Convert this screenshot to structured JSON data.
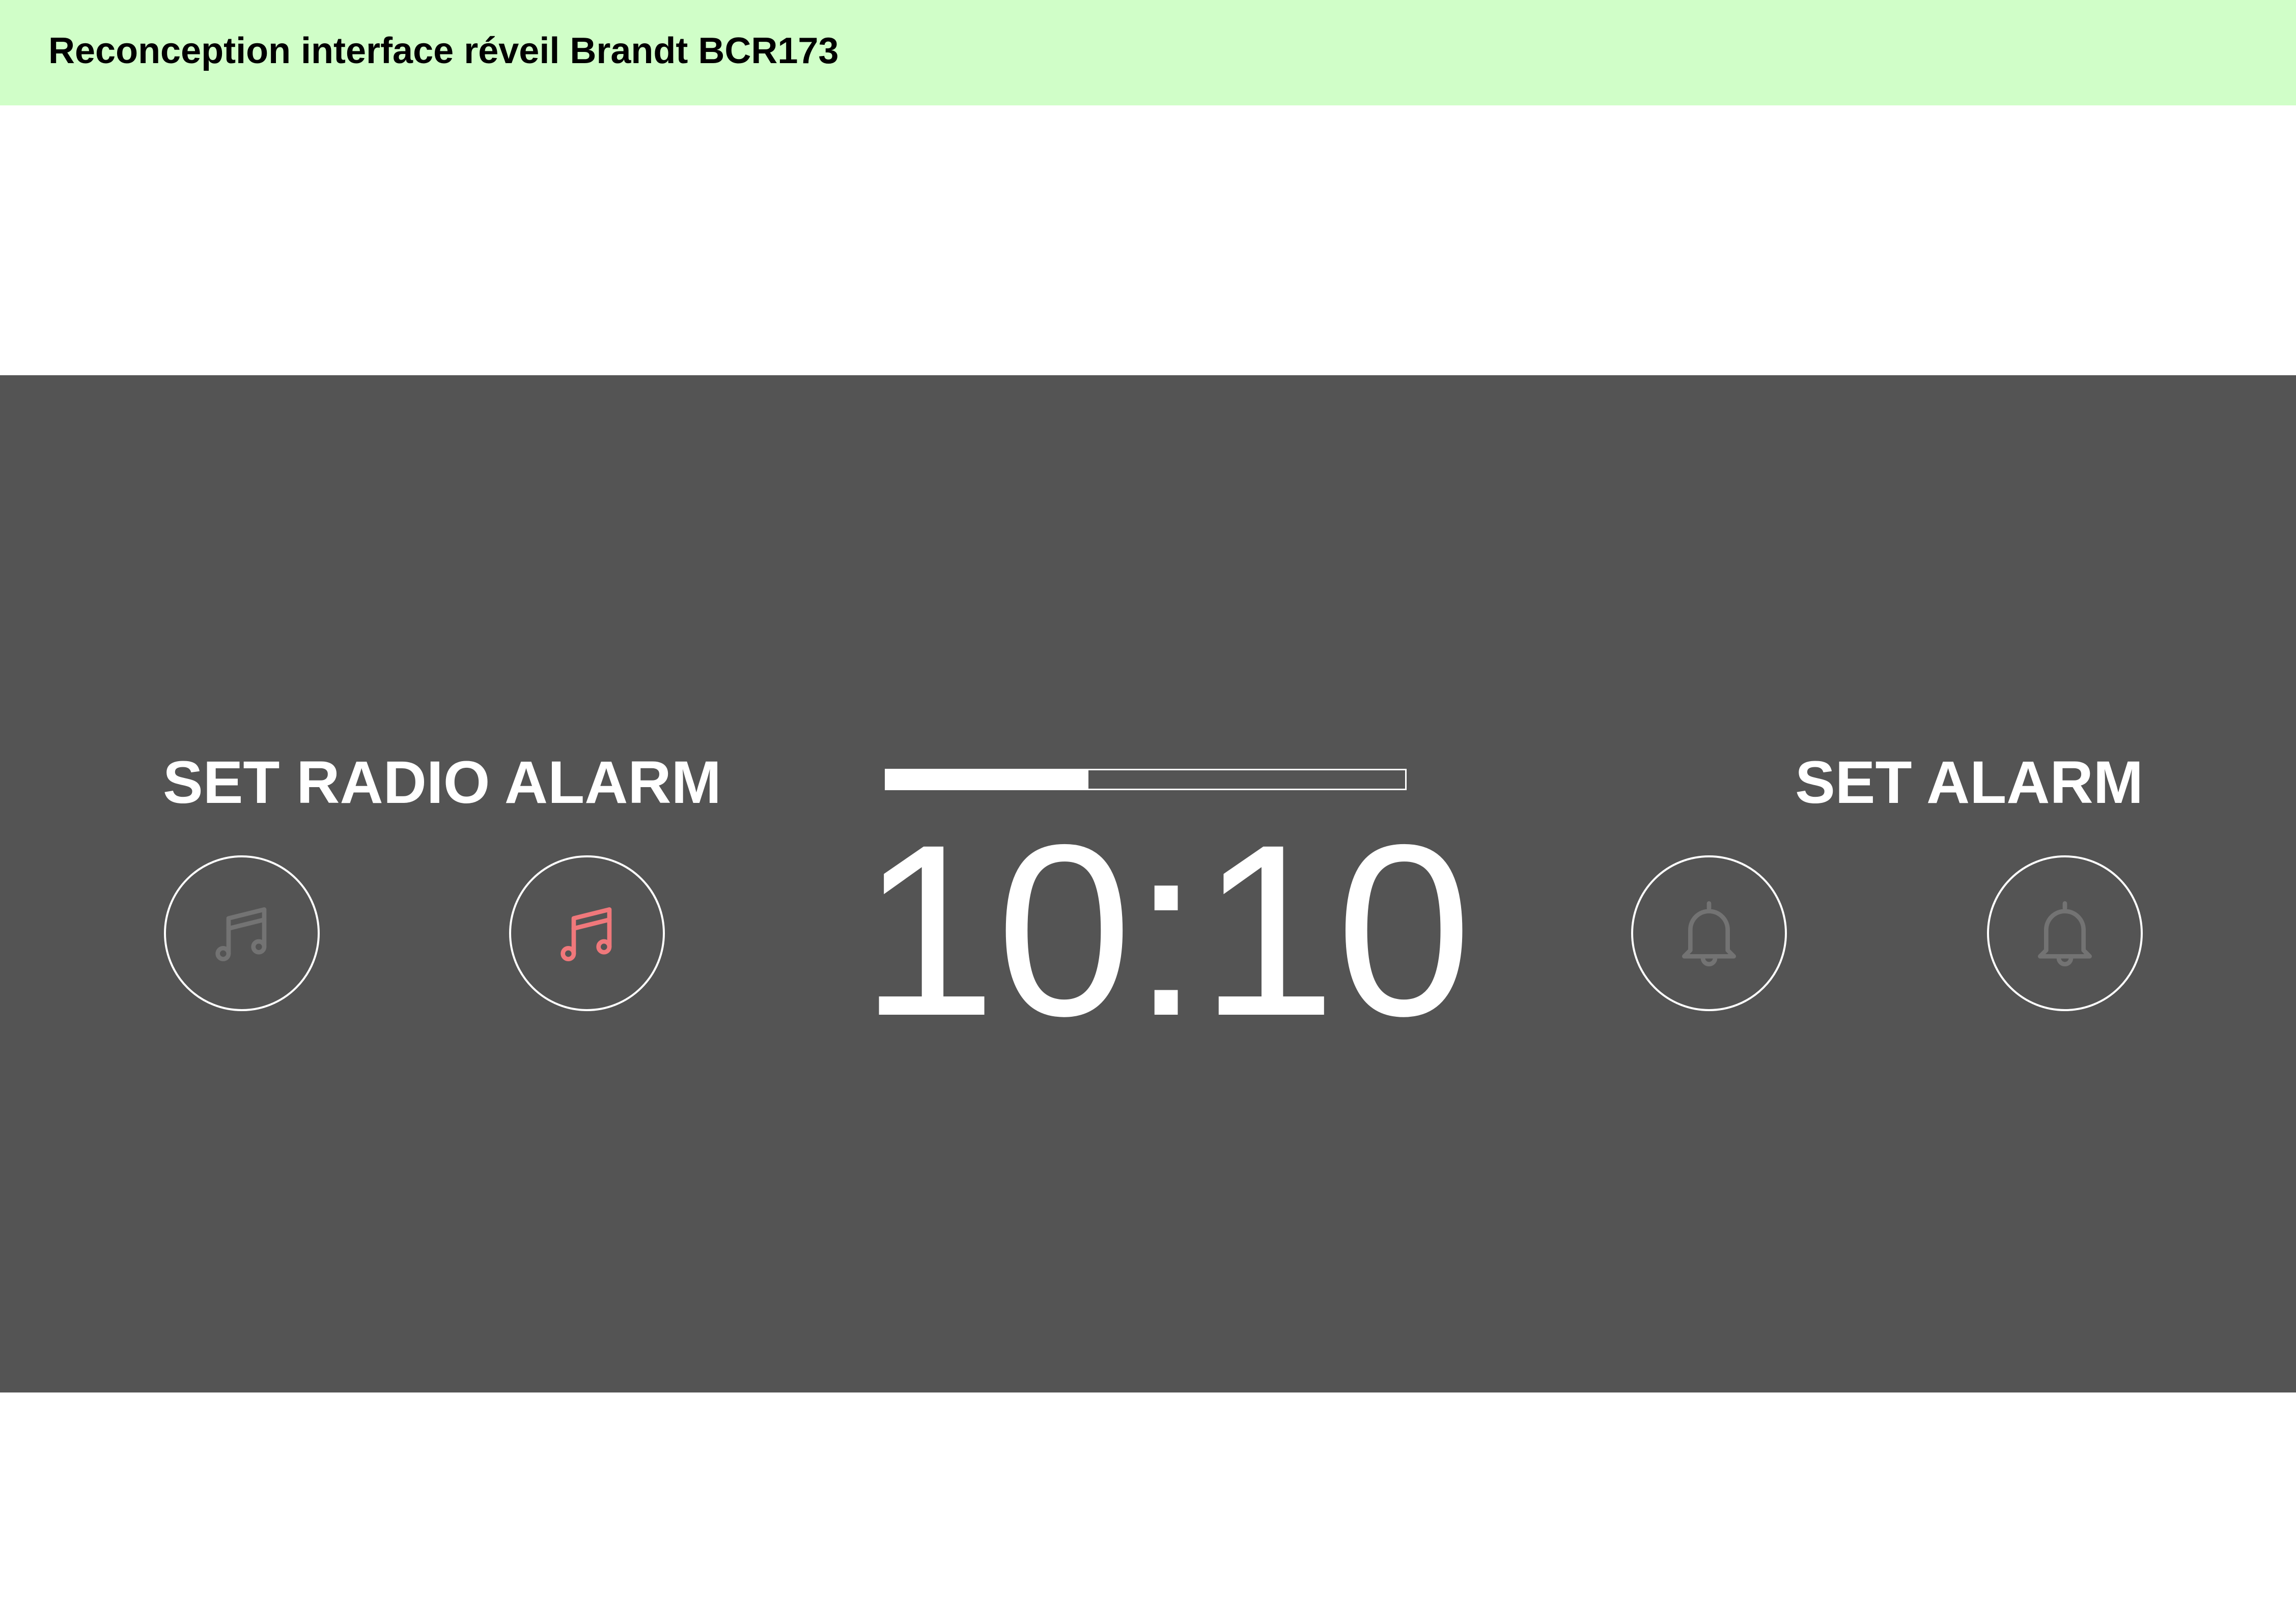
{
  "header": {
    "title": "Reconception interface réveil Brandt BCR173"
  },
  "radio_alarm": {
    "label": "SET RADIO ALARM",
    "buttons": [
      {
        "icon": "music-note-icon",
        "state": "inactive",
        "color": "#737373"
      },
      {
        "icon": "music-note-icon",
        "state": "active",
        "color": "#f0787b"
      }
    ]
  },
  "clock": {
    "time": "10:10",
    "progress": 0.39
  },
  "alarm": {
    "label": "SET ALARM",
    "buttons": [
      {
        "icon": "bell-icon",
        "state": "inactive",
        "color": "#737373"
      },
      {
        "icon": "bell-icon",
        "state": "inactive",
        "color": "#737373"
      }
    ]
  },
  "colors": {
    "header_bg": "#d0fec8",
    "panel_bg": "#545454",
    "foreground": "#ffffff",
    "icon_inactive": "#737373",
    "icon_active": "#f0787b"
  }
}
